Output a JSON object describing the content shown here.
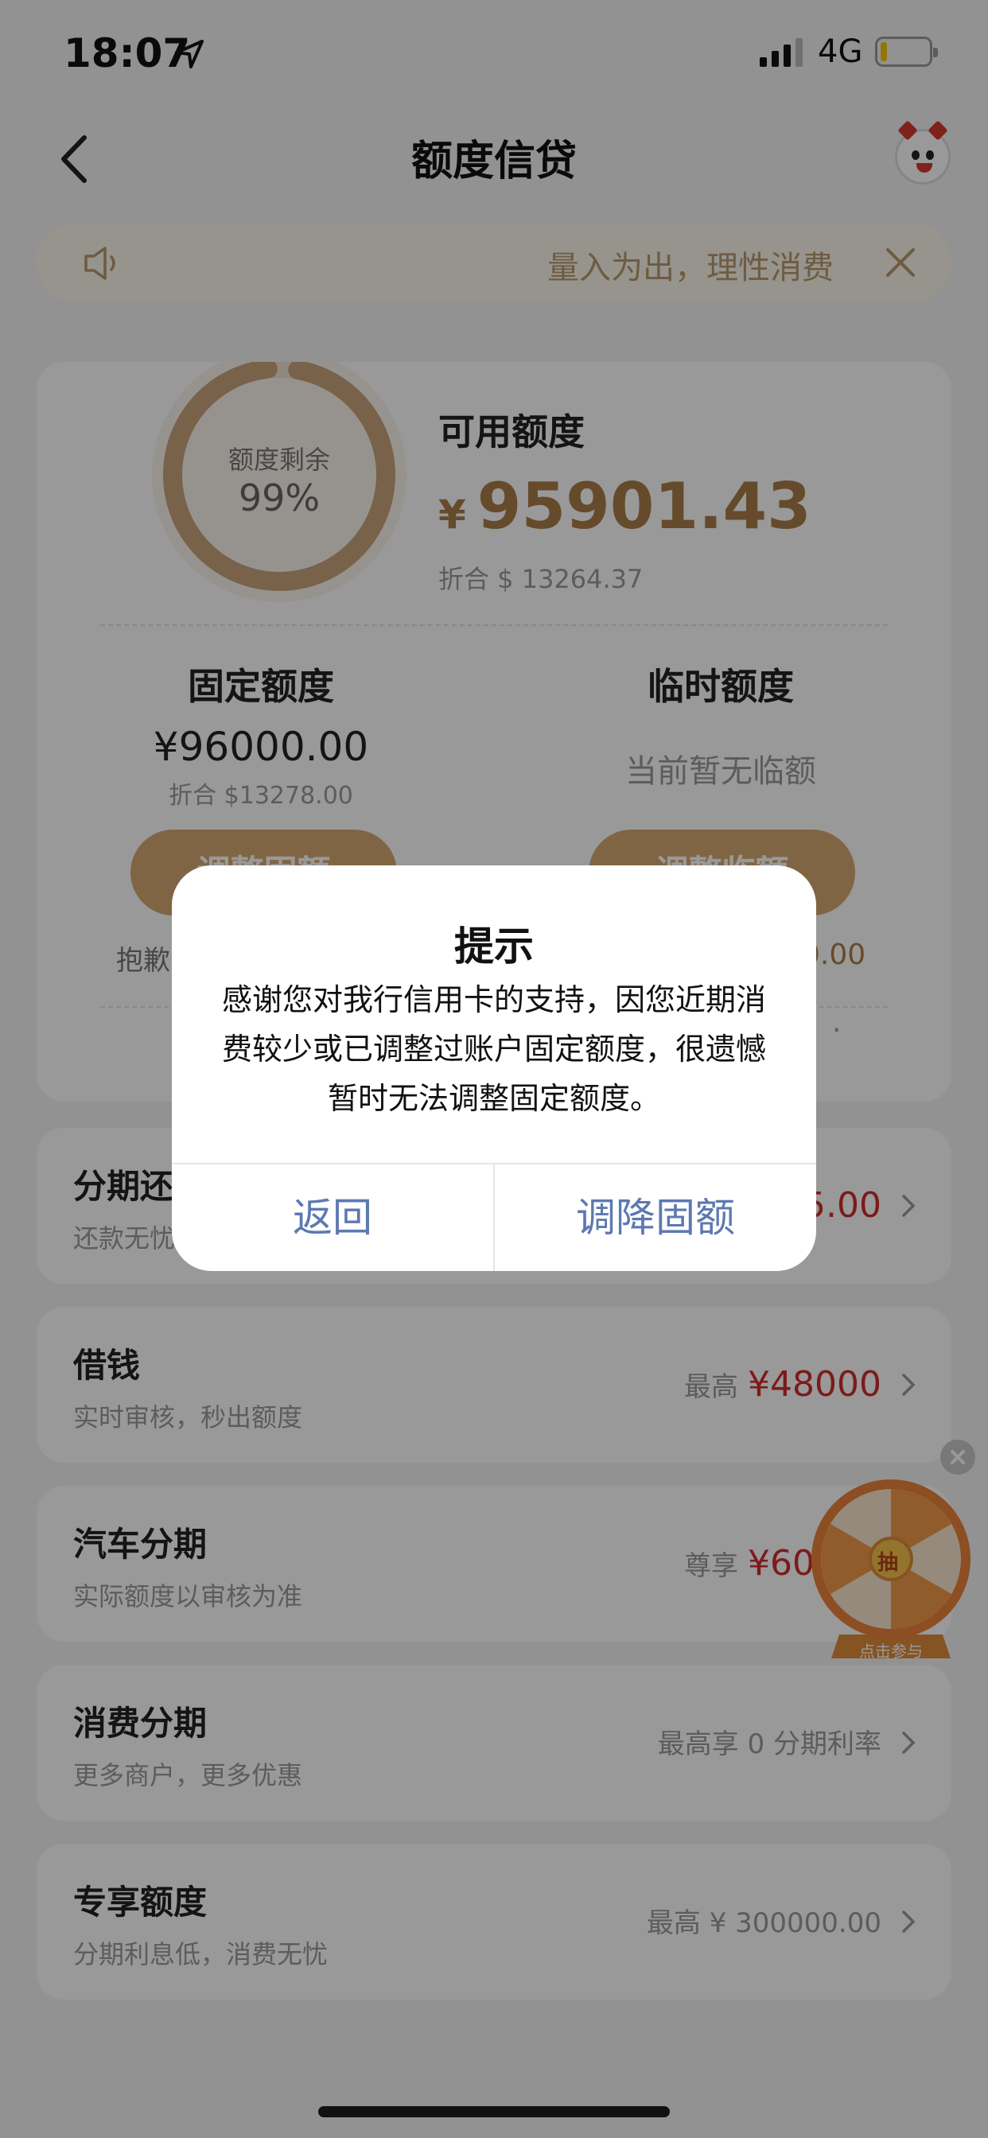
{
  "status_bar": {
    "time": "18:07",
    "network": "4G",
    "battery_percent": 5
  },
  "nav": {
    "title": "额度信贷"
  },
  "notice": {
    "text": "量入为出，理性消费"
  },
  "credit": {
    "ring_label": "额度剩余",
    "ring_percent_text": "99%",
    "ring_fraction": 0.99,
    "available_label": "可用额度",
    "currency": "¥",
    "available_amount": "95901.43",
    "available_usd": "折合 $ 13264.37",
    "fixed_title": "固定额度",
    "fixed_amount": "¥96000.00",
    "fixed_usd": "折合 $13278.00",
    "fixed_button": "调整固额",
    "temp_title": "临时额度",
    "temp_none": "当前暂无临额",
    "temp_button": "调整临额",
    "sorry_fragment": "抱歉",
    "right_fragment": "0.00",
    "dot_fragment": "."
  },
  "rows": [
    {
      "title": "分期还",
      "sub": "还款无忧",
      "right_label": "",
      "amount": "5.00"
    },
    {
      "title": "借钱",
      "sub": "实时审核，秒出额度",
      "right_label": "最高",
      "amount": "¥48000"
    },
    {
      "title": "汽车分期",
      "sub": "实际额度以审核为准",
      "right_label": "尊享",
      "amount": "¥60000"
    },
    {
      "title": "消费分期",
      "sub": "更多商户，更多优惠",
      "right_label": "最高享 0 分期利率",
      "amount": ""
    },
    {
      "title": "专享额度",
      "sub": "分期利息低，消费无忧",
      "right_label": "最高 ¥ 300000.00",
      "amount": ""
    }
  ],
  "wheel": {
    "center": "抽",
    "caption": "点击参与"
  },
  "dialog": {
    "title": "提示",
    "message": "感谢您对我行信用卡的支持，因您近期消费较少或已调整过账户固定额度，很遗憾暂时无法调整固定额度。",
    "cancel": "返回",
    "confirm": "调降固额"
  },
  "colors": {
    "gold": "#a97d48",
    "pill": "#d6a872",
    "red": "#d12c2c",
    "dialog_button": "#5d79b0"
  }
}
